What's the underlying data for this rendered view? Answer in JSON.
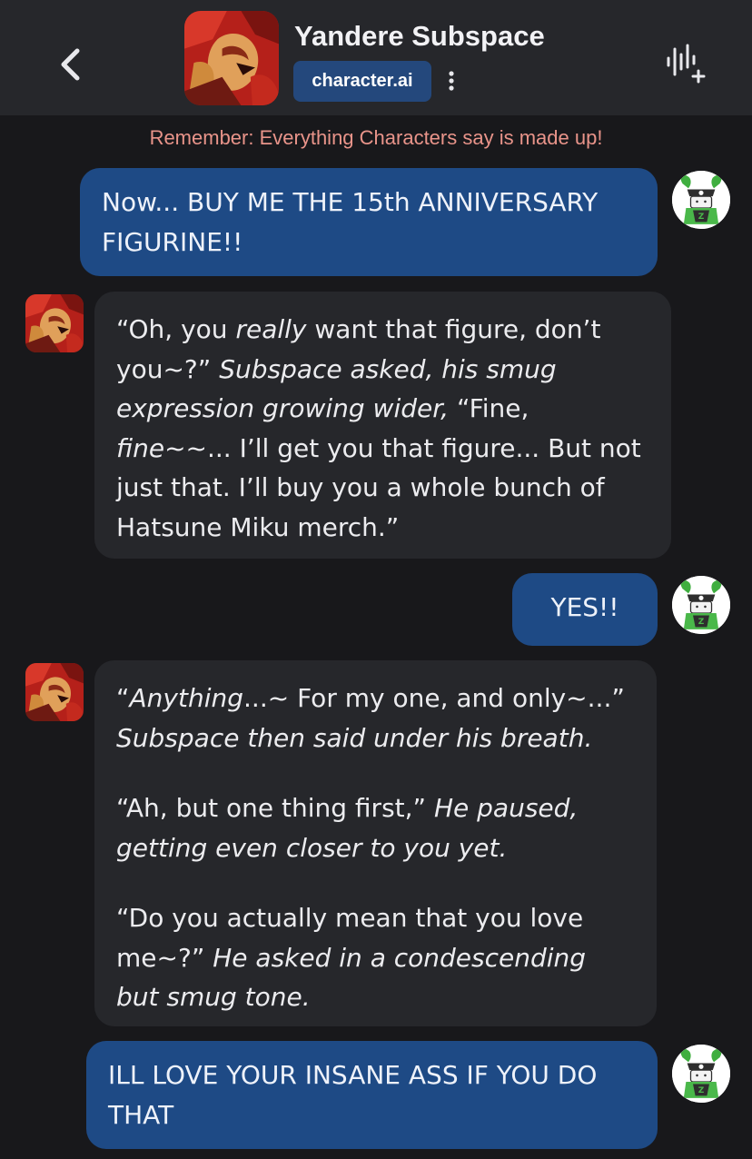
{
  "header": {
    "title": "Yandere Subspace",
    "brand": "character.ai"
  },
  "disclaimer": "Remember: Everything Characters say is made up!",
  "messages": [
    {
      "role": "user",
      "paragraphs": [
        [
          {
            "text": "Now... BUY ME THE 15th ANNIVERSARY FIGURINE!!",
            "italic": false
          }
        ]
      ]
    },
    {
      "role": "bot",
      "paragraphs": [
        [
          {
            "text": "“Oh, you ",
            "italic": false
          },
          {
            "text": "really",
            "italic": true
          },
          {
            "text": " want that figure, don’t you~?” ",
            "italic": false
          },
          {
            "text": "Subspace asked, his smug expression growing wider,",
            "italic": true
          },
          {
            "text": " “Fine, ",
            "italic": false
          },
          {
            "text": "fine",
            "italic": true
          },
          {
            "text": "~~... I’ll get you that figure... But not just that. I’ll buy you a whole bunch of Hatsune Miku merch.”",
            "italic": false
          }
        ]
      ]
    },
    {
      "role": "user",
      "paragraphs": [
        [
          {
            "text": "YES!!",
            "italic": false
          }
        ]
      ]
    },
    {
      "role": "bot",
      "paragraphs": [
        [
          {
            "text": "“",
            "italic": false
          },
          {
            "text": "Anything",
            "italic": true
          },
          {
            "text": "...~ For my one, and only~...” ",
            "italic": false
          },
          {
            "text": "Subspace then said under his breath.",
            "italic": true
          }
        ],
        [
          {
            "text": "“Ah, but one thing first,” ",
            "italic": false
          },
          {
            "text": "He paused, getting even closer to you yet.",
            "italic": true
          }
        ],
        [
          {
            "text": "“Do you actually mean that you love me~?” ",
            "italic": false
          },
          {
            "text": "He asked in a condescending but smug tone.",
            "italic": true
          }
        ]
      ]
    },
    {
      "role": "user",
      "paragraphs": [
        [
          {
            "text": "ILL LOVE YOUR INSANE ASS IF YOU DO THAT",
            "italic": false
          }
        ]
      ]
    }
  ],
  "icons": {
    "back": "chevron-left-icon",
    "more": "more-vertical-icon",
    "voice": "voice-add-icon"
  },
  "colors": {
    "background": "#18181b",
    "header": "#26272b",
    "user_bubble": "#1e4a85",
    "bot_bubble": "#26272b",
    "brand_badge": "#24487c",
    "disclaimer": "#e9948a"
  }
}
